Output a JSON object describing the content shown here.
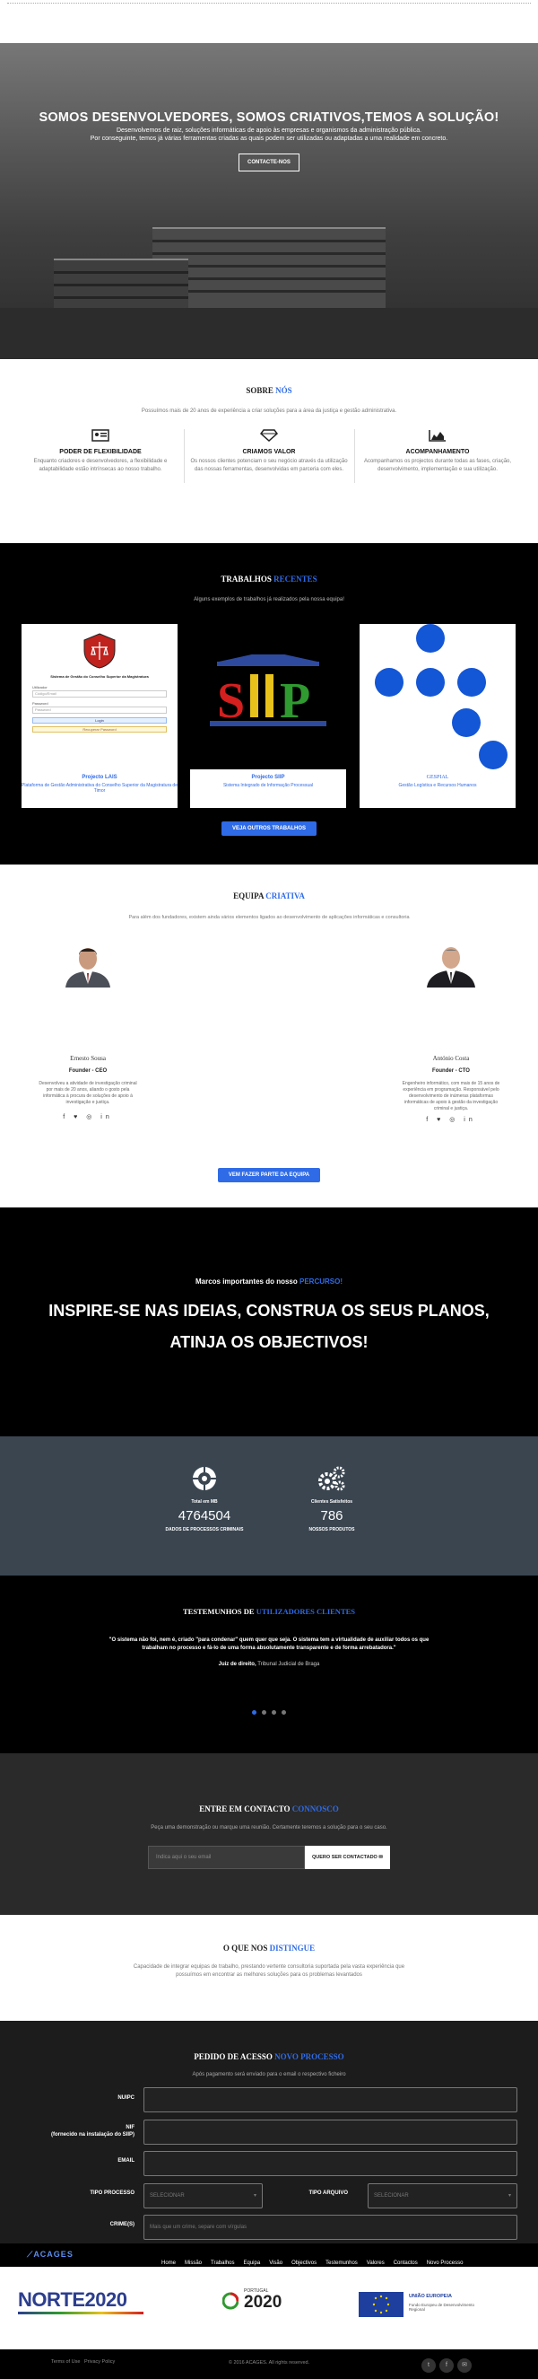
{
  "hero": {
    "title": "SOMOS DESENVOLVEDORES, SOMOS CRIATIVOS,TEMOS A SOLUÇÃO!",
    "line1": "Desenvolvemos de raiz, soluções informáticas de apoio às empresas e organismos da administração pública.",
    "line2": "Por conseguinte, temos já várias ferramentas criadas as quais podem ser utilizadas ou adaptadas a uma realidade em concreto.",
    "button": "CONTACTE-NOS"
  },
  "sobre": {
    "title_a": "SOBRE ",
    "title_b": "NÓS",
    "subtitle": "Possuímos mais de 20 anos de experiência a criar soluções para a área da justiça e gestão administrativa.",
    "features": [
      {
        "icon": "id-card-icon",
        "title": "PODER DE FLEXIBILIDADE",
        "desc": "Enquanto criadores e desenvolvedores, a flexibilidade e adaptabilidade estão intrínsecas ao nosso trabalho."
      },
      {
        "icon": "diamond-icon",
        "title": "CRIAMOS VALOR",
        "desc": "Os nossos clientes potenciam o seu negócio através da utilização das nossas ferramentas, desenvolvidas em parceria com eles."
      },
      {
        "icon": "area-chart-icon",
        "title": "ACOMPANHAMENTO",
        "desc": "Acompanhamos os projectos durante todas as fases, criação, desenvolvimento, implementação e sua utilização."
      }
    ]
  },
  "trabalhos": {
    "title_a": "TRABALHOS ",
    "title_b": "RECENTES",
    "subtitle": "Alguns exemplos de trabalhos já realizados pela nossa equipa!",
    "cards": [
      {
        "title": "Projecto LAIS",
        "desc": "Plataforma de Gestão Administrativa do Conselho Superior da Magistratura de Timor",
        "login_title": "Sistema de Gestão do Conselho Superior da Magistratura",
        "user_label": "Utilizador",
        "user_ph": "Código/Email",
        "pass_label": "Password",
        "pass_ph": "Password",
        "login_btn": "Login",
        "forgot": "Recuperar Password"
      },
      {
        "title": "Projecto SIIP",
        "desc": "Sistema Integrado de Informação Processual",
        "logo": "SIIP"
      },
      {
        "title": "GESPIAL",
        "desc": "Gestão Logística e Recursos Humanos"
      }
    ],
    "button": "VEJA OUTROS TRABALHOS"
  },
  "equipa": {
    "title_a": "EQUIPA ",
    "title_b": "CRIATIVA",
    "subtitle": "Para além dos fundadores, existem ainda vários elementos ligados ao desenvolvimento de aplicações informáticas e consultoria",
    "members": [
      {
        "name": "Ernesto Sousa",
        "role": "Founder - CEO",
        "desc": "Desenvolveu a atividade de investigação criminal por mais de 20 anos, aliando o gosto pela informática à procura de soluções de apoio à investigação e justiça."
      },
      {
        "name": "António Costa",
        "role": "Founder - CTO",
        "desc": "Engenheiro informático, com mais de 15 anos de experiência em programação. Responsável pelo desenvolvimento de inúmeras plataformas informáticas de apoio à gestão da investigação criminal e justiça."
      }
    ],
    "social": "f ♥ ◎ in",
    "button": "VEM FAZER PARTE DA EQUIPA"
  },
  "marcos": {
    "small_a": "Marcos importantes do nosso ",
    "small_b": "PERCURSO!",
    "line1": "INSPIRE-SE NAS IDEIAS, CONSTRUA OS SEUS PLANOS,",
    "line2": "ATINJA OS OBJECTIVOS!"
  },
  "stats": [
    {
      "icon": "database-icon",
      "label": "Total em MB",
      "number": "4764504",
      "footer": "DADOS DE PROCESSOS CRIMINAIS"
    },
    {
      "icon": "gears-icon",
      "label": "Clientes Satisfeitos",
      "number": "786",
      "footer": "NOSSOS PRODUTOS"
    }
  ],
  "testemunhos": {
    "title_a": "TESTEMUNHOS DE ",
    "title_b": "UTILIZADORES CLIENTES",
    "quote": "\"O sistema não foi, nem é, criado \"para condenar\" quem quer que seja. O sistema tem a virtualidade de auxiliar todos os que trabalham no processo e fá-lo de uma forma absolutamente transparente e de forma arrebatadora.\"",
    "author_role": "Juiz de direito,",
    "author_org": " Tribunal Judicial de Braga"
  },
  "contacto": {
    "title_a": "ENTRE EM CONTACTO ",
    "title_b": "CONNOSCO",
    "subtitle": "Peça uma demonstração ou marque uma reunião. Certamente teremos a solução para o seu caso.",
    "placeholder": "Indica aqui o seu email",
    "button": "QUERO SER CONTACTADO"
  },
  "distingue": {
    "title_a": "O QUE NOS ",
    "title_b": "DISTINGUE",
    "text": "Capacidade de integrar equipas de trabalho, prestando vertente consultoria suportada pela vasta experiência que possuímos em encontrar as melhores soluções para os problemas levantados"
  },
  "pedido": {
    "title_a": "PEDIDO DE ACESSO ",
    "title_b": "NOVO PROCESSO",
    "subtitle": "Após pagamento será enviado para o email o respectivo ficheiro",
    "fields": {
      "nuipc": "NUIPC",
      "nif": "NIF",
      "nif_sub": "(fornecido na instalação do SIIP)",
      "email": "EMAIL",
      "tipo_processo": "TIPO PROCESSO",
      "tipo_arquivo": "TIPO ARQUIVO",
      "crimes": "CRIME(S)"
    },
    "select_ph": "SELECIONAR",
    "crimes_ph": "Mais que um crime, separe com vírgulas"
  },
  "nav": {
    "logo": "ACAGES",
    "items": [
      "Home",
      "Missão",
      "Trabalhos",
      "Equipa",
      "Visão",
      "Objectivos",
      "Testemunhos",
      "Valores",
      "Contactos",
      "Novo Processo"
    ]
  },
  "logos": {
    "norte": "NORTE2020",
    "portugal_top": "PORTUGAL",
    "portugal_bottom": "2020",
    "ue_title": "UNIÃO EUROPEIA",
    "ue_sub": "Fundo Europeu de Desenvolvimento Regional"
  },
  "footer": {
    "links": "Terms of Use   Privacy Policy",
    "copy": "© 2016 ACAGES. All rights reserved."
  },
  "colors": {
    "accent": "#2f6be6",
    "dark": "#000000",
    "slate": "#3a4550",
    "form": "#1c1c1c"
  }
}
